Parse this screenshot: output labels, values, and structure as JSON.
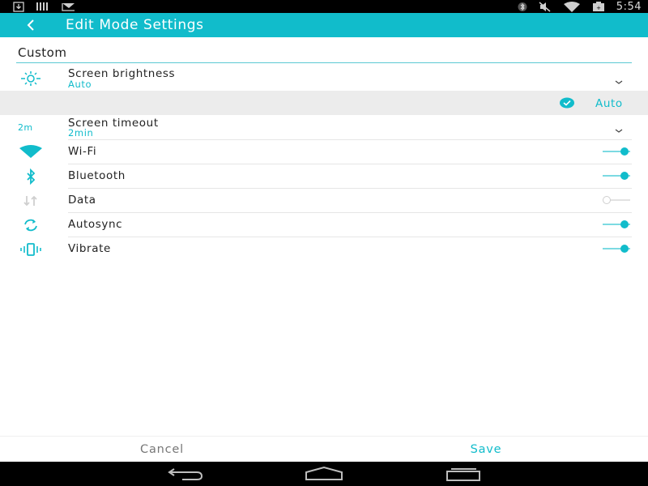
{
  "status_bar": {
    "time": "5:54",
    "left_icons": [
      "download-icon",
      "barcode-icon",
      "mail-icon"
    ],
    "right_icons": [
      "bluetooth-icon",
      "mute-icon",
      "wifi-icon",
      "battery-icon"
    ]
  },
  "app_bar": {
    "title": "Edit Mode Settings",
    "back_icon": "back-arrow-icon",
    "color": "#11bccb"
  },
  "section": {
    "title": "Custom"
  },
  "settings": {
    "brightness": {
      "title": "Screen brightness",
      "value": "Auto",
      "icon": "brightness-icon"
    },
    "brightness_option": {
      "label": "Auto",
      "selected": true
    },
    "timeout": {
      "title": "Screen timeout",
      "value": "2min",
      "icon_text": "2m"
    },
    "wifi": {
      "title": "Wi-Fi",
      "enabled": true,
      "icon": "wifi-icon"
    },
    "bluetooth": {
      "title": "Bluetooth",
      "enabled": true,
      "icon": "bluetooth-icon"
    },
    "data": {
      "title": "Data",
      "enabled": false,
      "icon": "data-arrows-icon"
    },
    "autosync": {
      "title": "Autosync",
      "enabled": true,
      "icon": "sync-icon"
    },
    "vibrate": {
      "title": "Vibrate",
      "enabled": true,
      "icon": "vibrate-icon"
    }
  },
  "actions": {
    "cancel": "Cancel",
    "save": "Save"
  },
  "nav_bar": {
    "icons": [
      "back-nav-icon",
      "home-nav-icon",
      "recents-nav-icon"
    ]
  }
}
